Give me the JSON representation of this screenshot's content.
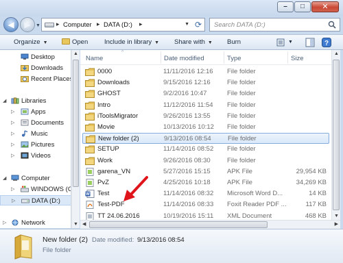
{
  "address": {
    "crumbs": [
      "Computer",
      "DATA (D:)"
    ],
    "search_placeholder": "Search DATA (D:)"
  },
  "toolbar": {
    "organize": "Organize",
    "open": "Open",
    "include_in_library": "Include in library",
    "share_with": "Share with",
    "burn": "Burn"
  },
  "nav": {
    "favorites": [
      {
        "label": "Desktop",
        "icon": "desktop-icon"
      },
      {
        "label": "Downloads",
        "icon": "downloads-icon"
      },
      {
        "label": "Recent Places",
        "icon": "recent-places-icon"
      }
    ],
    "libraries": {
      "label": "Libraries",
      "items": [
        {
          "label": "Apps",
          "icon": "apps-icon"
        },
        {
          "label": "Documents",
          "icon": "documents-icon"
        },
        {
          "label": "Music",
          "icon": "music-icon"
        },
        {
          "label": "Pictures",
          "icon": "pictures-icon"
        },
        {
          "label": "Videos",
          "icon": "videos-icon"
        }
      ]
    },
    "computer": {
      "label": "Computer",
      "items": [
        {
          "label": "WINDOWS (C:",
          "icon": "windows-drive-icon"
        },
        {
          "label": "DATA (D:)",
          "icon": "drive-icon",
          "selected": true
        }
      ]
    },
    "network": {
      "label": "Network"
    }
  },
  "columns": {
    "name": "Name",
    "date": "Date modified",
    "type": "Type",
    "size": "Size"
  },
  "files": [
    {
      "name": "0000",
      "date": "11/11/2016 12:16",
      "type": "File folder",
      "size": "",
      "icon": "folder-icon"
    },
    {
      "name": "Downloads",
      "date": "9/15/2016 12:16",
      "type": "File folder",
      "size": "",
      "icon": "folder-icon"
    },
    {
      "name": "GHOST",
      "date": "9/2/2016 10:47",
      "type": "File folder",
      "size": "",
      "icon": "folder-icon"
    },
    {
      "name": "Intro",
      "date": "11/12/2016 11:54",
      "type": "File folder",
      "size": "",
      "icon": "folder-icon"
    },
    {
      "name": "iToolsMigrator",
      "date": "9/26/2016 13:55",
      "type": "File folder",
      "size": "",
      "icon": "folder-icon"
    },
    {
      "name": "Movie",
      "date": "10/13/2016 10:12",
      "type": "File folder",
      "size": "",
      "icon": "folder-icon"
    },
    {
      "name": "New folder (2)",
      "date": "9/13/2016 08:54",
      "type": "File folder",
      "size": "",
      "icon": "folder-icon",
      "selected": true
    },
    {
      "name": "SETUP",
      "date": "11/14/2016 08:52",
      "type": "File folder",
      "size": "",
      "icon": "folder-icon"
    },
    {
      "name": "Work",
      "date": "9/26/2016 08:30",
      "type": "File folder",
      "size": "",
      "icon": "folder-icon"
    },
    {
      "name": "garena_VN",
      "date": "5/27/2016 15:15",
      "type": "APK File",
      "size": "29,954 KB",
      "icon": "apk-file-icon"
    },
    {
      "name": "PvZ",
      "date": "4/25/2016 10:18",
      "type": "APK File",
      "size": "34,269 KB",
      "icon": "apk-file-icon"
    },
    {
      "name": "Test",
      "date": "11/14/2016 08:32",
      "type": "Microsoft Word D...",
      "size": "14 KB",
      "icon": "word-document-icon"
    },
    {
      "name": "Test-PDF",
      "date": "11/14/2016 08:33",
      "type": "Foxit Reader PDF ...",
      "size": "117 KB",
      "icon": "pdf-file-icon"
    },
    {
      "name": "TT 24.06.2016",
      "date": "10/19/2016 15:11",
      "type": "XML Document",
      "size": "468 KB",
      "icon": "xml-document-icon"
    }
  ],
  "details": {
    "name": "New folder (2)",
    "modified_label": "Date modified:",
    "modified_value": "9/13/2016 08:54",
    "type": "File folder"
  },
  "colors": {
    "folder": "#e8c45a",
    "selection": "#d9e8f9",
    "annotation_arrow": "#e0151b"
  }
}
